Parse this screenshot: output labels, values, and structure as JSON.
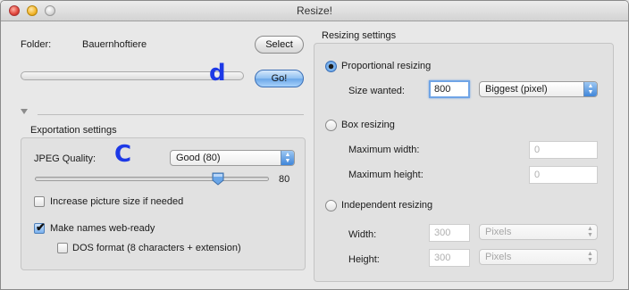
{
  "window": {
    "title": "Resize!"
  },
  "folder": {
    "label": "Folder:",
    "value": "Bauernhoftiere",
    "select_button": "Select",
    "go_button": "Go!"
  },
  "annotations": {
    "d": "d",
    "c": "C"
  },
  "export": {
    "title": "Exportation settings",
    "jpeg_label": "JPEG Quality:",
    "jpeg_value": "Good (80)",
    "quality_value": "80",
    "quality_level": 80,
    "increase_label": "Increase picture size if needed",
    "increase_checked": false,
    "webready_label": "Make names web-ready",
    "webready_checked": true,
    "dos_label": "DOS format (8 characters + extension)",
    "dos_checked": false
  },
  "resizing": {
    "title": "Resizing settings",
    "proportional_label": "Proportional resizing",
    "size_wanted_label": "Size wanted:",
    "size_wanted_value": "800",
    "size_mode": "Biggest (pixel)",
    "box_label": "Box resizing",
    "max_width_label": "Maximum width:",
    "max_width_value": "0",
    "max_height_label": "Maximum height:",
    "max_height_value": "0",
    "independent_label": "Independent resizing",
    "width_label": "Width:",
    "width_value": "300",
    "width_unit": "Pixels",
    "height_label": "Height:",
    "height_value": "300",
    "height_unit": "Pixels",
    "selected_mode": "proportional"
  },
  "colors": {
    "annotation": "#1d39e6",
    "accent": "#4e8fdd"
  }
}
